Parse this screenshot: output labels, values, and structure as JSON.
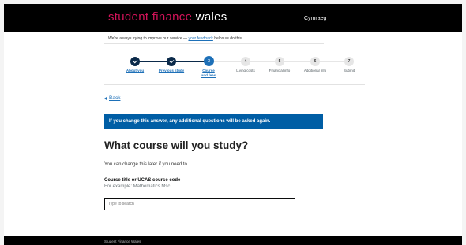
{
  "header": {
    "logo_part1": "student finance",
    "logo_part2": "wales",
    "language_link": "Cymraeg"
  },
  "banner": {
    "prefix": "We're always trying to improve our service — ",
    "link": "your feedback",
    "suffix": " helps us do this."
  },
  "steps": [
    {
      "number": "1",
      "label": "About you",
      "status": "complete"
    },
    {
      "number": "2",
      "label": "Previous study",
      "status": "complete"
    },
    {
      "number": "3",
      "label": "Course and fees",
      "status": "current"
    },
    {
      "number": "4",
      "label": "Living costs",
      "status": "todo"
    },
    {
      "number": "5",
      "label": "Financial info",
      "status": "todo"
    },
    {
      "number": "6",
      "label": "Additional info",
      "status": "todo"
    },
    {
      "number": "7",
      "label": "Submit",
      "status": "todo"
    }
  ],
  "back_link": "Back",
  "notice": "If you change this answer, any additional questions will be asked again.",
  "heading": "What course will you study?",
  "hint": "You can change this later if you need to.",
  "field": {
    "label": "Course title or UCAS course code",
    "hint": "For example: Mathematics Msc",
    "placeholder": "Type to search",
    "value": ""
  },
  "footer": {
    "text": "Student Finance Wales"
  },
  "colors": {
    "brand_pink": "#d4145a",
    "link_blue": "#1d70b8",
    "notice_blue": "#005ea5",
    "step_complete": "#0b2a4a"
  }
}
